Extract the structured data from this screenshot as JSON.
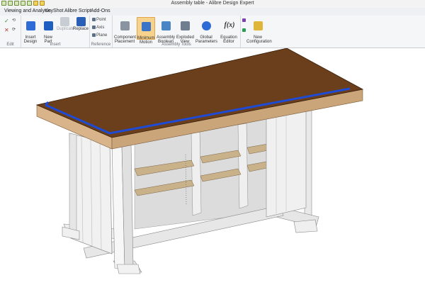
{
  "window": {
    "title": "Assembly table - Alibre Design Expert"
  },
  "menu": [
    {
      "label": "Viewing and Analysis"
    },
    {
      "label": "KeyShot"
    },
    {
      "label": "Alibre Script"
    },
    {
      "label": "Add-Ons"
    }
  ],
  "ribbon": {
    "groups": {
      "edit": "Edit",
      "insert": "Insert",
      "reference": "Reference",
      "assembly_tools": "Assembly Tools"
    },
    "edit_small": [
      "✓",
      "✕"
    ],
    "insert_design": "Insert\nDesign",
    "new_part": "New\nPart",
    "duplicate": "Duplicate",
    "replace": "Replace",
    "point": "Point",
    "axis": "Axis",
    "plane": "Plane",
    "component_placement": "Component\nPlacement",
    "minimum_motion": "Minimum\nMotion",
    "assembly_boolean": "Assembly\nBoolean",
    "exploded_view": "Exploded\nView",
    "global_parameters": "Global\nParameters",
    "equation_editor": "Equation\nEditor",
    "equation_glyph": "f(x)",
    "new_configuration": "New\nConfiguration"
  },
  "colors": {
    "tabletop": "#6b3f1b",
    "tabletop_edge": "#d9b48a",
    "blue_trim": "#1e4bd6",
    "shelf": "#c9b28a",
    "frame": "#f2f2f2",
    "highlight": "#f6d28c"
  },
  "icons": {
    "insert_design": "insert-design-icon",
    "new_part": "new-part-icon",
    "duplicate": "duplicate-icon",
    "replace": "replace-icon",
    "component_placement": "component-placement-icon",
    "minimum_motion": "minimum-motion-icon",
    "assembly_boolean": "assembly-boolean-icon",
    "exploded_view": "exploded-view-icon",
    "global_parameters": "global-parameters-icon",
    "equation_editor": "equation-editor-icon",
    "new_configuration": "new-configuration-icon"
  }
}
